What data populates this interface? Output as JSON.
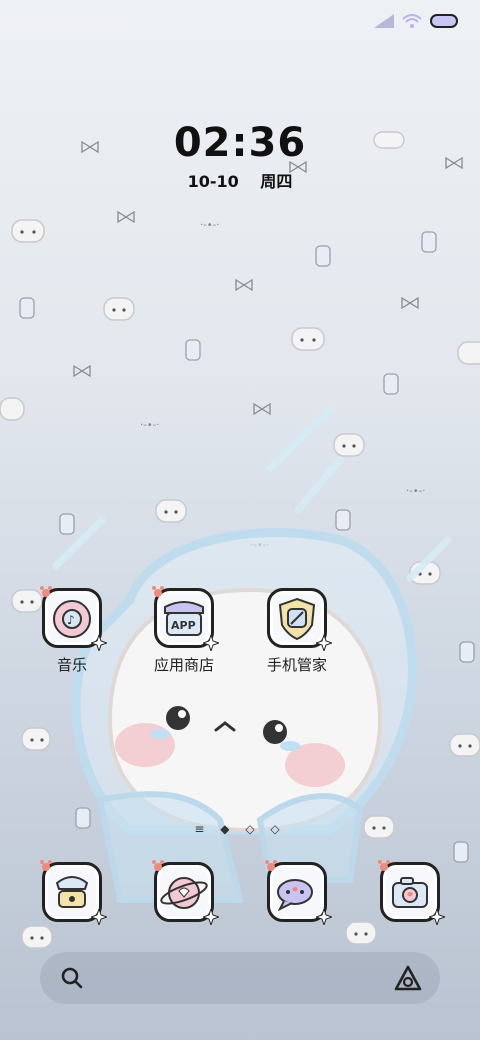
{
  "clock": {
    "time": "02:36",
    "date": "10-10",
    "weekday": "周四"
  },
  "status_bar": {
    "icons": [
      "signal-icon",
      "wifi-icon",
      "battery-icon"
    ],
    "accent": "#b9b4f0"
  },
  "apps_row": [
    {
      "label": "音乐",
      "icon": "music-icon"
    },
    {
      "label": "应用商店",
      "icon": "app-store-icon"
    },
    {
      "label": "手机管家",
      "icon": "phone-manager-icon"
    }
  ],
  "dock": [
    {
      "icon": "phone-icon"
    },
    {
      "icon": "browser-icon"
    },
    {
      "icon": "messages-icon"
    },
    {
      "icon": "camera-icon"
    }
  ],
  "page_indicator": "≡ ◆ ◇ ◇",
  "search_bar": {
    "icons": [
      "search-icon",
      "assistant-icon"
    ]
  }
}
